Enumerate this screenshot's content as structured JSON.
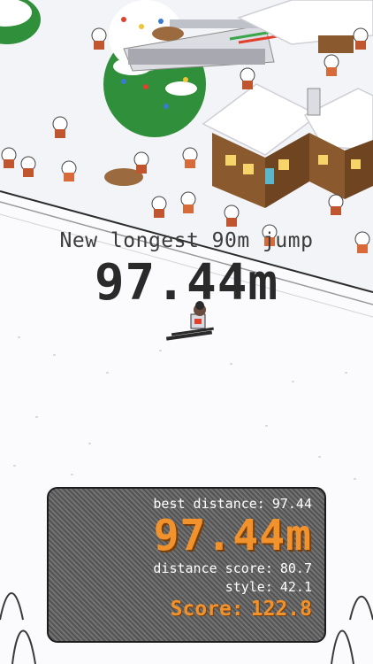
{
  "hud": {
    "banner_message": "New longest 90m jump",
    "banner_distance": "97.44m"
  },
  "results": {
    "best_distance_label": "best distance:",
    "best_distance_value": "97.44",
    "distance": "97.44m",
    "distance_score_label": "distance score:",
    "distance_score_value": "80.7",
    "style_label": "style:",
    "style_value": "42.1",
    "score_label": "Score:",
    "score_value": "122.8"
  },
  "colors": {
    "accent_orange": "#f2922c",
    "panel_gray": "#6a6a6a",
    "snow": "#fbfbfd",
    "tree_green": "#2f8f3a",
    "roof_brown": "#8a5a2e"
  }
}
